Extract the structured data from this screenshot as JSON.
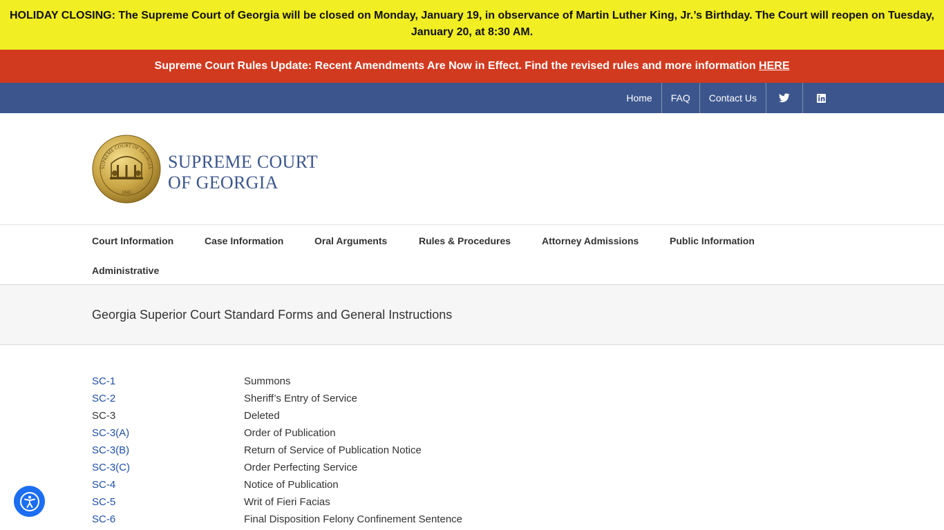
{
  "alerts": {
    "holiday_line1": "HOLIDAY CLOSING: The Supreme Court of Georgia will be closed on Monday, January 19, in observance of Martin Luther King, Jr.’s Birthday. The Court will reopen on Tuesday,",
    "holiday_line2": "January 20, at 8:30 AM.",
    "rules_text": "Supreme Court Rules Update:  Recent Amendments Are Now in Effect. Find the revised rules and more information ",
    "rules_link": "HERE"
  },
  "topnav": {
    "home": "Home",
    "faq": "FAQ",
    "contact": "Contact Us",
    "twitter_icon": "twitter-icon",
    "linkedin_icon": "linkedin-icon"
  },
  "brand": {
    "line1": "SUPREME COURT",
    "line2": "OF GEORGIA",
    "seal_text_top": "SUPREME COURT OF GEORGIA",
    "seal_year": "1845"
  },
  "mainnav": {
    "court_info": "Court Information",
    "case_info": "Case Information",
    "oral_args": "Oral Arguments",
    "rules": "Rules & Procedures",
    "attorney": "Attorney Admissions",
    "public": "Public Information",
    "admin": "Administrative"
  },
  "page": {
    "title": "Georgia Superior Court Standard Forms and General Instructions"
  },
  "forms": [
    {
      "code": "SC-1",
      "desc": "Summons",
      "link": true
    },
    {
      "code": "SC-2",
      "desc": "Sheriff’s Entry of Service",
      "link": true
    },
    {
      "code": "SC-3",
      "desc": "Deleted",
      "link": false
    },
    {
      "code": "SC-3(A)",
      "desc": "Order of Publication",
      "link": true
    },
    {
      "code": "SC-3(B)",
      "desc": "Return of Service of Publication Notice",
      "link": true
    },
    {
      "code": "SC-3(C)",
      "desc": "Order Perfecting Service",
      "link": true
    },
    {
      "code": "SC-4",
      "desc": "Notice of Publication",
      "link": true
    },
    {
      "code": "SC-5",
      "desc": "Writ of Fieri Facias",
      "link": true
    },
    {
      "code": "SC-6",
      "desc": "Final Disposition Felony Confinement Sentence",
      "link": true
    }
  ],
  "colors": {
    "holiday_bg": "#f1ee24",
    "rules_bg": "#d13a1f",
    "topbar_bg": "#3c568d",
    "link": "#1f4fa8",
    "accessibility": "#1b6df2"
  },
  "accessibility_icon": "accessibility-icon"
}
